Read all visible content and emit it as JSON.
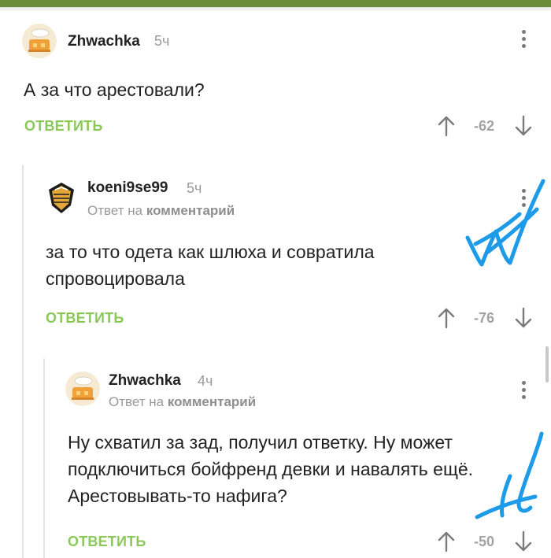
{
  "comments": [
    {
      "username": "Zhwachka",
      "time": "5ч",
      "text": "А за что арестовали?",
      "reply_button": "ОТВЕТИТЬ",
      "score": "-62"
    },
    {
      "username": "koeni9se99",
      "time": "5ч",
      "reply_prefix": "Ответ на",
      "reply_link": "комментарий",
      "text": "за то что одета как шлюха и совратила спровоцировала",
      "reply_button": "ОТВЕТИТЬ",
      "score": "-76"
    },
    {
      "username": "Zhwachka",
      "time": "4ч",
      "reply_prefix": "Ответ на",
      "reply_link": "комментарий",
      "text": "Ну схватил за зад, получил ответку. Ну может подключиться бойфренд девки и навалять ещё. Арестовывать-то нафига?",
      "reply_button": "ОТВЕТИТЬ",
      "score": "-50"
    }
  ],
  "colors": {
    "accent_green": "#8ac858",
    "top_bar": "#6b8b3a",
    "scribble_blue": "#1e9be8"
  },
  "icons": [
    "avatar-zhwachka",
    "avatar-koenigsegg",
    "more-vert-icon",
    "arrow-up-icon",
    "arrow-down-icon"
  ]
}
